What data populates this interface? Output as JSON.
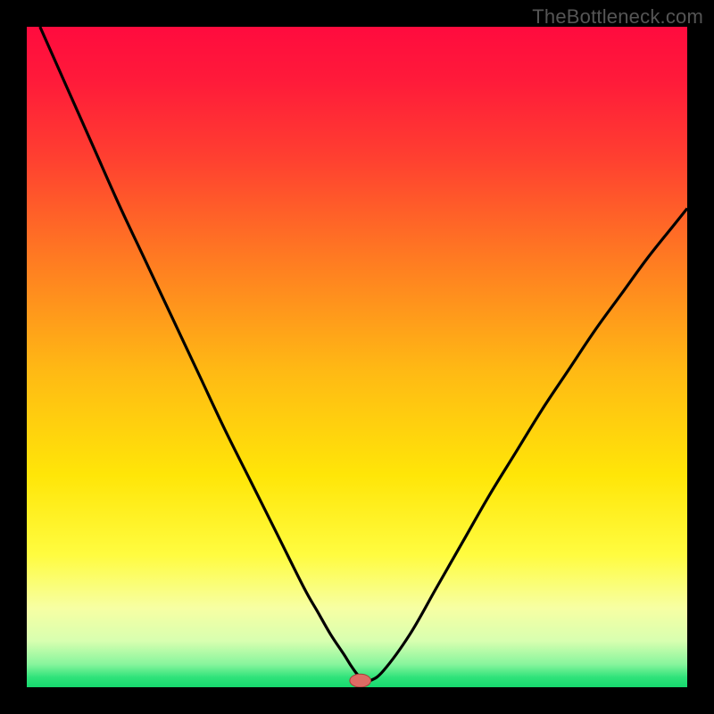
{
  "watermark": "TheBottleneck.com",
  "colors": {
    "frame": "#000000",
    "watermark": "#555555",
    "gradient_stops": [
      {
        "offset": 0.0,
        "color": "#ff0b3e"
      },
      {
        "offset": 0.08,
        "color": "#ff1a3a"
      },
      {
        "offset": 0.2,
        "color": "#ff4030"
      },
      {
        "offset": 0.35,
        "color": "#ff7a22"
      },
      {
        "offset": 0.52,
        "color": "#ffb914"
      },
      {
        "offset": 0.68,
        "color": "#ffe608"
      },
      {
        "offset": 0.8,
        "color": "#fffc40"
      },
      {
        "offset": 0.88,
        "color": "#f7ffa3"
      },
      {
        "offset": 0.93,
        "color": "#d8ffb0"
      },
      {
        "offset": 0.965,
        "color": "#88f59d"
      },
      {
        "offset": 0.985,
        "color": "#2fe37a"
      },
      {
        "offset": 1.0,
        "color": "#16d96e"
      }
    ],
    "curve": "#000000",
    "marker_fill": "#de6b64",
    "marker_stroke": "#a33e39"
  },
  "chart_data": {
    "type": "line",
    "title": "",
    "xlabel": "",
    "ylabel": "",
    "xlim": [
      0,
      100
    ],
    "ylim": [
      0,
      100
    ],
    "grid": false,
    "legend": false,
    "series": [
      {
        "name": "bottleneck-curve",
        "x": [
          2,
          6,
          10,
          14,
          18,
          22,
          26,
          30,
          34,
          38,
          42,
          44,
          46,
          48,
          49,
          50,
          51,
          52,
          54,
          58,
          62,
          66,
          70,
          74,
          78,
          82,
          86,
          90,
          94,
          98,
          100
        ],
        "y": [
          100,
          91,
          82,
          73,
          64.5,
          56,
          47.5,
          39,
          31,
          23,
          15,
          11.5,
          8,
          5,
          3.4,
          2,
          1,
          1,
          2.5,
          8,
          15,
          22,
          29,
          35.5,
          42,
          48,
          54,
          59.5,
          65,
          70,
          72.5
        ]
      }
    ],
    "marker": {
      "x": 50.5,
      "y": 1,
      "rx": 1.6,
      "ry": 1.0
    }
  }
}
